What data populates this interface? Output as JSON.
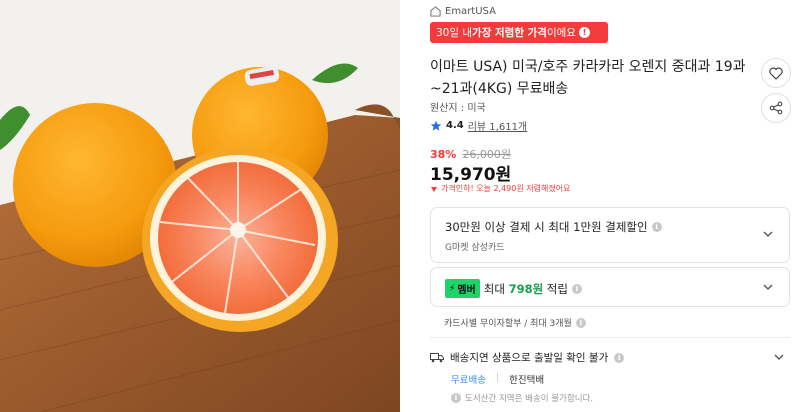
{
  "store": {
    "name": "EmartUSA",
    "icon": "store-icon"
  },
  "banner": {
    "prefix": "30일 내 ",
    "bold": "가장 저렴한 가격",
    "suffix": "이에요",
    "color": "#f23b3b"
  },
  "product": {
    "title": "이마트 USA) 미국/호주 카라카라 오렌지 중대과 19과~21과(4KG) 무료배송",
    "origin": "원산지 : 미국",
    "rating": "4.4",
    "review": "리뷰 1,611개",
    "discount_pct": "38%",
    "original_price": "26,000원",
    "price": "15,970원",
    "price_drop": "가격인하! 오늘 2,490원 저렴해졌어요"
  },
  "promo": {
    "line1": "30만원 이상 결제 시 최대 1만원 결제할인",
    "line2": "G마켓 삼성카드"
  },
  "member": {
    "badge": "멤버",
    "prefix": "최대 ",
    "amount": "798원",
    "suffix": " 적립"
  },
  "card_plan": "카드사별 무이자할부 / 최대 3개월",
  "delivery": {
    "notice": "배송지연 상품으로 출발일 확인 불가",
    "free_label": "무료배송",
    "carrier": "한진택배",
    "restriction": "도서산간 지역은 배송이 불가합니다."
  },
  "colors": {
    "accent_red": "#f23b3b",
    "member_green": "#1fd36a",
    "link_blue": "#3a8ee6"
  }
}
